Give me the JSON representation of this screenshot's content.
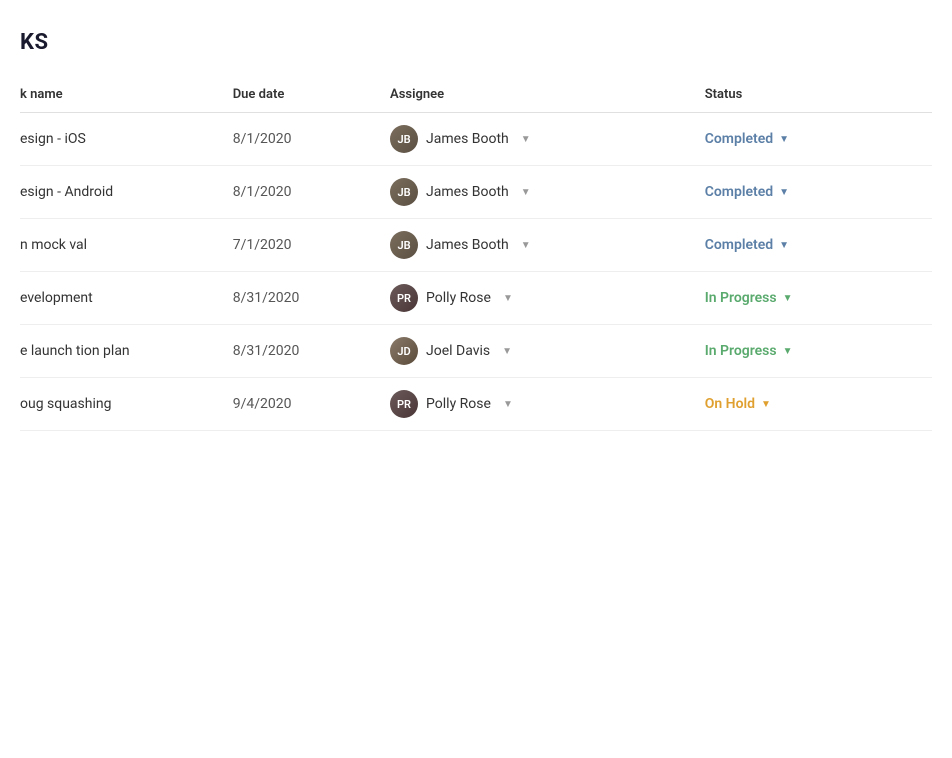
{
  "page": {
    "title": "KS"
  },
  "table": {
    "columns": [
      {
        "key": "task_name",
        "label": "k name"
      },
      {
        "key": "due_date",
        "label": "Due date"
      },
      {
        "key": "assignee",
        "label": "Assignee"
      },
      {
        "key": "status",
        "label": "Status"
      }
    ],
    "rows": [
      {
        "id": 1,
        "task_name": "esign - iOS",
        "due_date": "8/1/2020",
        "assignee": "James Booth",
        "assignee_initials": "JB",
        "assignee_type": "james",
        "status": "Completed",
        "status_type": "completed"
      },
      {
        "id": 2,
        "task_name": "esign - Android",
        "due_date": "8/1/2020",
        "assignee": "James Booth",
        "assignee_initials": "JB",
        "assignee_type": "james",
        "status": "Completed",
        "status_type": "completed"
      },
      {
        "id": 3,
        "task_name": "n mock val",
        "due_date": "7/1/2020",
        "assignee": "James Booth",
        "assignee_initials": "JB",
        "assignee_type": "james",
        "status": "Completed",
        "status_type": "completed"
      },
      {
        "id": 4,
        "task_name": "evelopment",
        "due_date": "8/31/2020",
        "assignee": "Polly Rose",
        "assignee_initials": "PR",
        "assignee_type": "polly",
        "status": "In Progress",
        "status_type": "inprogress"
      },
      {
        "id": 5,
        "task_name": "e launch tion plan",
        "due_date": "8/31/2020",
        "assignee": "Joel Davis",
        "assignee_initials": "JD",
        "assignee_type": "joel",
        "status": "In Progress",
        "status_type": "inprogress"
      },
      {
        "id": 6,
        "task_name": "oug squashing",
        "due_date": "9/4/2020",
        "assignee": "Polly Rose",
        "assignee_initials": "PR",
        "assignee_type": "polly",
        "status": "On Hold",
        "status_type": "onhold"
      }
    ]
  }
}
